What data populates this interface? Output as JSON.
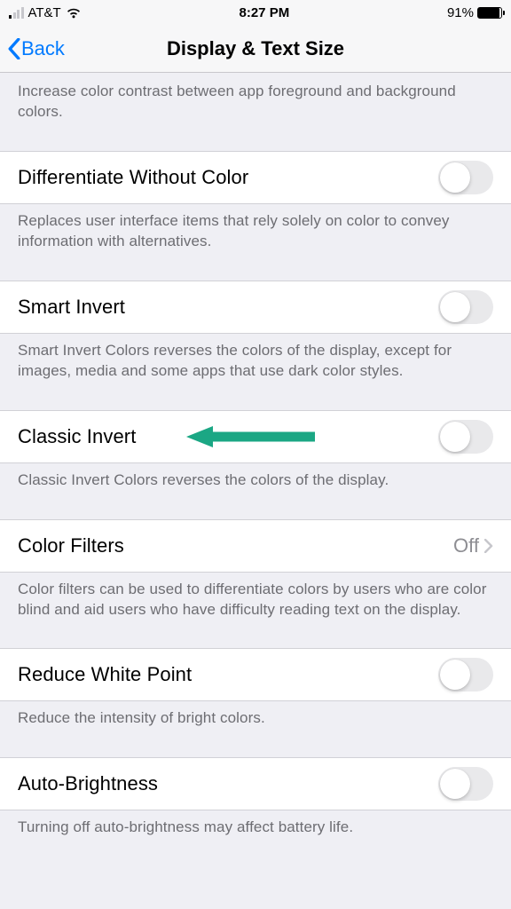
{
  "statusBar": {
    "carrier": "AT&T",
    "time": "8:27 PM",
    "batteryPercent": "91%"
  },
  "nav": {
    "back": "Back",
    "title": "Display & Text Size"
  },
  "sections": {
    "contrastDesc": "Increase color contrast between app foreground and background colors.",
    "diffColor": {
      "label": "Differentiate Without Color",
      "desc": "Replaces user interface items that rely solely on color to convey information with alternatives."
    },
    "smartInvert": {
      "label": "Smart Invert",
      "desc": "Smart Invert Colors reverses the colors of the display, except for images, media and some apps that use dark color styles."
    },
    "classicInvert": {
      "label": "Classic Invert",
      "desc": "Classic Invert Colors reverses the colors of the display."
    },
    "colorFilters": {
      "label": "Color Filters",
      "value": "Off",
      "desc": "Color filters can be used to differentiate colors by users who are color blind and aid users who have difficulty reading text on the display."
    },
    "reduceWhite": {
      "label": "Reduce White Point",
      "desc": "Reduce the intensity of bright colors."
    },
    "autoBright": {
      "label": "Auto-Brightness",
      "desc": "Turning off auto-brightness may affect battery life."
    }
  }
}
